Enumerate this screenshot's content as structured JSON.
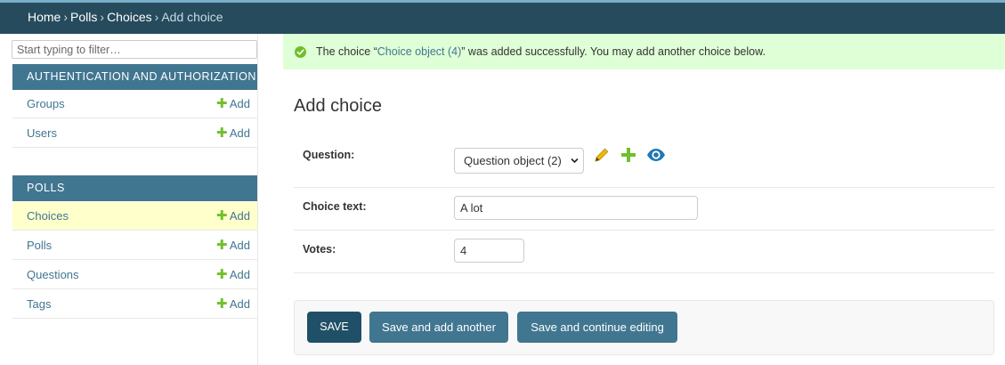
{
  "breadcrumbs": {
    "items": [
      "Home",
      "Polls",
      "Choices"
    ],
    "separator": "›",
    "current": "Add choice"
  },
  "sidebar": {
    "filter_placeholder": "Start typing to filter…",
    "modules": [
      {
        "caption": "AUTHENTICATION AND AUTHORIZATION",
        "models": [
          {
            "name": "Groups",
            "add_label": "Add"
          },
          {
            "name": "Users",
            "add_label": "Add"
          }
        ]
      },
      {
        "caption": "POLLS",
        "models": [
          {
            "name": "Choices",
            "add_label": "Add",
            "current": true
          },
          {
            "name": "Polls",
            "add_label": "Add"
          },
          {
            "name": "Questions",
            "add_label": "Add"
          },
          {
            "name": "Tags",
            "add_label": "Add"
          }
        ]
      }
    ]
  },
  "message": {
    "prefix": "The choice “",
    "link": "Choice object (4)",
    "suffix": "” was added successfully. You may add another choice below."
  },
  "form": {
    "title": "Add choice",
    "question_label": "Question:",
    "question_value": "Question object (2)",
    "choice_text_label": "Choice text:",
    "choice_text_value": "A lot",
    "votes_label": "Votes:",
    "votes_value": "4"
  },
  "buttons": {
    "save": "SAVE",
    "save_add_another": "Save and add another",
    "save_continue": "Save and continue editing"
  },
  "colors": {
    "header_bg": "#264b5d",
    "module_bg": "#417690",
    "success_bg": "#dfffd6",
    "add_green": "#70bf2b",
    "current_row_bg": "#ffffcc"
  }
}
